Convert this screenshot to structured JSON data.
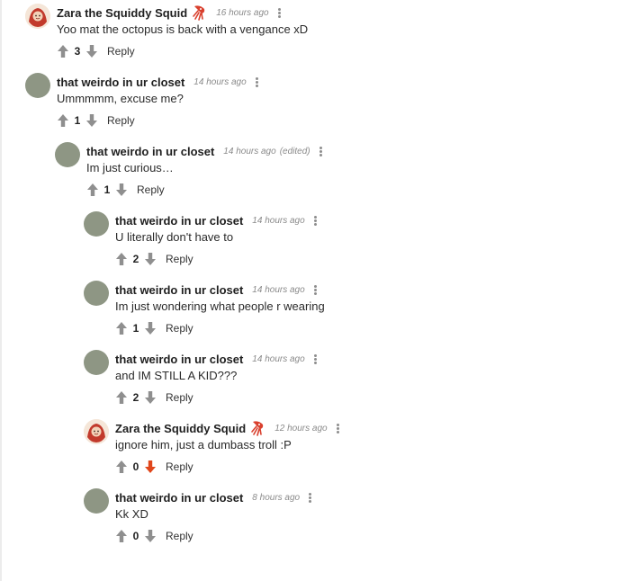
{
  "comments": [
    {
      "author": "Zara the Squiddy Squid",
      "time": "16 hours ago",
      "edited": "",
      "text": "Yoo mat the octopus is back with a vengance xD",
      "score": "3",
      "reply": "Reply",
      "downvoted": false,
      "avatar": "zara-avatar"
    },
    {
      "author": "that weirdo in ur closet",
      "time": "14 hours ago",
      "edited": "",
      "text": "Ummmmm, excuse me?",
      "score": "1",
      "reply": "Reply",
      "downvoted": false,
      "avatar": "default-avatar"
    },
    {
      "author": "that weirdo in ur closet",
      "time": "14 hours ago",
      "edited": "(edited)",
      "text": "Im just curious…",
      "score": "1",
      "reply": "Reply",
      "downvoted": false,
      "avatar": "default-avatar"
    },
    {
      "author": "that weirdo in ur closet",
      "time": "14 hours ago",
      "edited": "",
      "text": "U literally don't have to",
      "score": "2",
      "reply": "Reply",
      "downvoted": false,
      "avatar": "default-avatar"
    },
    {
      "author": "that weirdo in ur closet",
      "time": "14 hours ago",
      "edited": "",
      "text": "Im just wondering what people r wearing",
      "score": "1",
      "reply": "Reply",
      "downvoted": false,
      "avatar": "default-avatar"
    },
    {
      "author": "that weirdo in ur closet",
      "time": "14 hours ago",
      "edited": "",
      "text": "and IM STILL A KID???",
      "score": "2",
      "reply": "Reply",
      "downvoted": false,
      "avatar": "default-avatar"
    },
    {
      "author": "Zara the Squiddy Squid",
      "time": "12 hours ago",
      "edited": "",
      "text": "ignore him, just a dumbass troll :P",
      "score": "0",
      "reply": "Reply",
      "downvoted": true,
      "avatar": "zara-avatar"
    },
    {
      "author": "that weirdo in ur closet",
      "time": "8 hours ago",
      "edited": "",
      "text": "Kk XD",
      "score": "0",
      "reply": "Reply",
      "downvoted": false,
      "avatar": "default-avatar"
    }
  ],
  "colors": {
    "vote_gray": "#8f8f8f",
    "downvote_active": "#e0461b",
    "avatar_default": "#8e9684"
  },
  "icons": {
    "upvote": "arrow-up-icon",
    "downvote": "arrow-down-icon",
    "menu": "vertical-dots-icon",
    "flair": "squid-flair-icon"
  }
}
